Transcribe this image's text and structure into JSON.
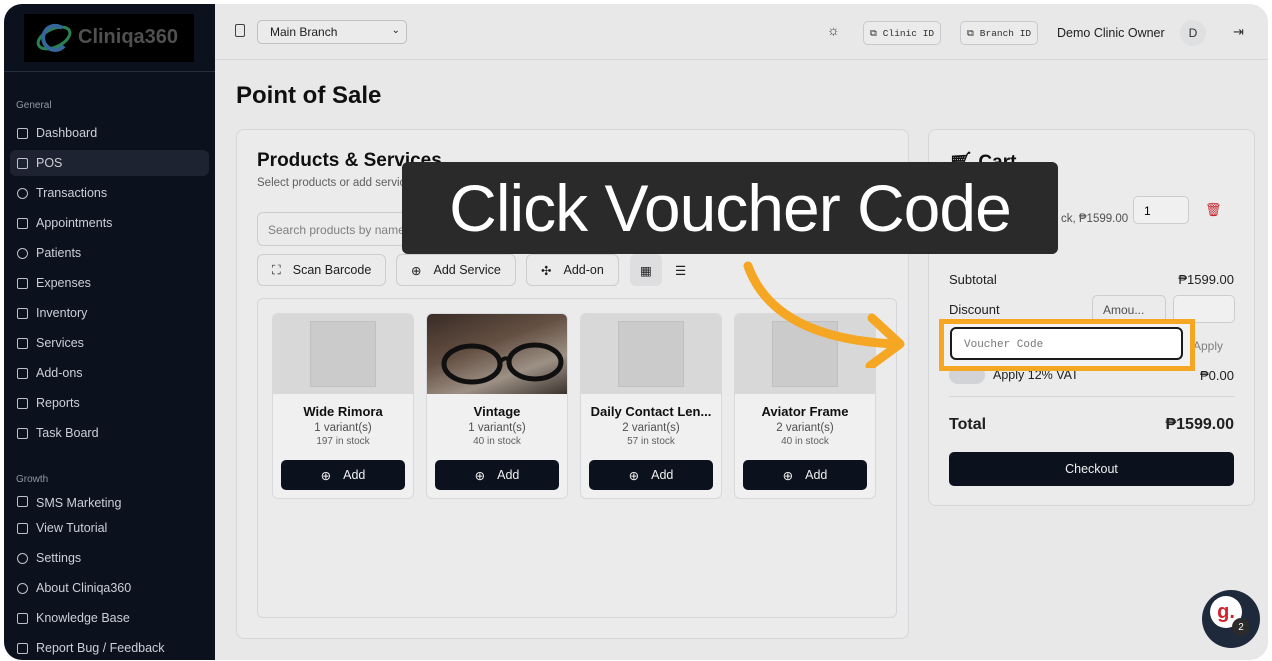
{
  "app": {
    "logo_text": "Cliniqa360"
  },
  "sidebar": {
    "section_general": "General",
    "items": [
      {
        "label": "Dashboard"
      },
      {
        "label": "POS"
      },
      {
        "label": "Transactions"
      },
      {
        "label": "Appointments"
      },
      {
        "label": "Patients"
      },
      {
        "label": "Expenses"
      },
      {
        "label": "Inventory"
      },
      {
        "label": "Services"
      },
      {
        "label": "Add-ons"
      },
      {
        "label": "Reports"
      },
      {
        "label": "Task Board"
      }
    ],
    "section_growth": "Growth",
    "growth_items": [
      {
        "label": "SMS Marketing"
      }
    ],
    "bottom_items": [
      {
        "label": "View Tutorial"
      },
      {
        "label": "Settings"
      },
      {
        "label": "About Cliniqa360"
      },
      {
        "label": "Knowledge Base"
      },
      {
        "label": "Report Bug / Feedback"
      }
    ]
  },
  "topbar": {
    "branch": "Main Branch",
    "clinic_id": "Clinic ID",
    "branch_id": "Branch ID",
    "owner": "Demo Clinic Owner",
    "avatar": "D"
  },
  "page": {
    "title": "Point of Sale"
  },
  "products": {
    "title": "Products & Services",
    "subtitle": "Select products or add services to the current",
    "search_placeholder": "Search products by name",
    "buttons": {
      "scan": "Scan Barcode",
      "add_service": "Add Service",
      "addon": "Add-on"
    },
    "items": [
      {
        "name": "Wide Rimora",
        "variants": "1 variant(s)",
        "stock": "197 in stock",
        "add": "Add"
      },
      {
        "name": "Vintage",
        "variants": "1 variant(s)",
        "stock": "40 in stock",
        "add": "Add"
      },
      {
        "name": "Daily Contact Len...",
        "variants": "2 variant(s)",
        "stock": "57 in stock",
        "add": "Add"
      },
      {
        "name": "Aviator Frame",
        "variants": "2 variant(s)",
        "stock": "40 in stock",
        "add": "Add"
      }
    ]
  },
  "cart": {
    "title": "Cart",
    "item_desc": "ck, ₱1599.00",
    "qty": "1",
    "subtotal_label": "Subtotal",
    "subtotal_value": "₱1599.00",
    "discount_label": "Discount",
    "discount_type": "Amou...",
    "voucher_placeholder": "Voucher Code",
    "apply_label": "Apply",
    "vat_label": "Apply 12% VAT",
    "vat_value": "₱0.00",
    "total_label": "Total",
    "total_value": "₱1599.00",
    "checkout": "Checkout"
  },
  "tutorial": {
    "banner": "Click Voucher Code",
    "accent": "#f5a623"
  },
  "chat": {
    "letter": "g.",
    "badge": "2"
  }
}
